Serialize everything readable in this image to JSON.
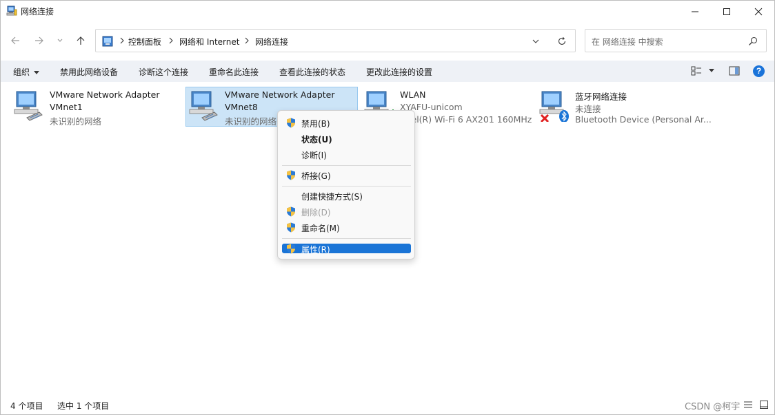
{
  "window": {
    "title": "网络连接"
  },
  "navigation": {
    "breadcrumbs": [
      "控制面板",
      "网络和 Internet",
      "网络连接"
    ],
    "search_placeholder": "在 网络连接 中搜索"
  },
  "commandbar": {
    "organize": "组织",
    "disable": "禁用此网络设备",
    "diagnose": "诊断这个连接",
    "rename": "重命名此连接",
    "view_status": "查看此连接的状态",
    "change_settings": "更改此连接的设置"
  },
  "connections": [
    {
      "name": "VMware Network Adapter",
      "line2": "VMnet1",
      "status": "未识别的网络",
      "selected": false
    },
    {
      "name": "VMware Network Adapter",
      "line2": "VMnet8",
      "status": "未识别的网络",
      "selected": true
    },
    {
      "name": "WLAN",
      "line2": "XYAFU-unicom",
      "status": "Intel(R) Wi-Fi 6 AX201 160MHz",
      "selected": false
    },
    {
      "name": "蓝牙网络连接",
      "line2": "未连接",
      "status": "Bluetooth Device (Personal Ar...",
      "selected": false
    }
  ],
  "context_menu": {
    "items": [
      {
        "label": "禁用(B)",
        "shield": true,
        "style": "normal"
      },
      {
        "label": "状态(U)",
        "shield": false,
        "style": "bold"
      },
      {
        "label": "诊断(I)",
        "shield": false,
        "style": "normal"
      },
      {
        "label": "桥接(G)",
        "shield": true,
        "style": "normal"
      },
      {
        "label": "创建快捷方式(S)",
        "shield": false,
        "style": "normal"
      },
      {
        "label": "删除(D)",
        "shield": true,
        "style": "disabled"
      },
      {
        "label": "重命名(M)",
        "shield": true,
        "style": "normal"
      },
      {
        "label": "属性(R)",
        "shield": true,
        "style": "highlight"
      }
    ]
  },
  "statusbar": {
    "item_count": "4 个项目",
    "selected_count": "选中 1 个项目",
    "watermark": "CSDN @柯宇"
  },
  "colors": {
    "selection_bg": "#cce4f7",
    "selection_border": "#99c9ef",
    "menu_highlight": "#1a74d6",
    "commandbar_bg": "#eef1f6",
    "help_blue": "#1a73d9"
  }
}
